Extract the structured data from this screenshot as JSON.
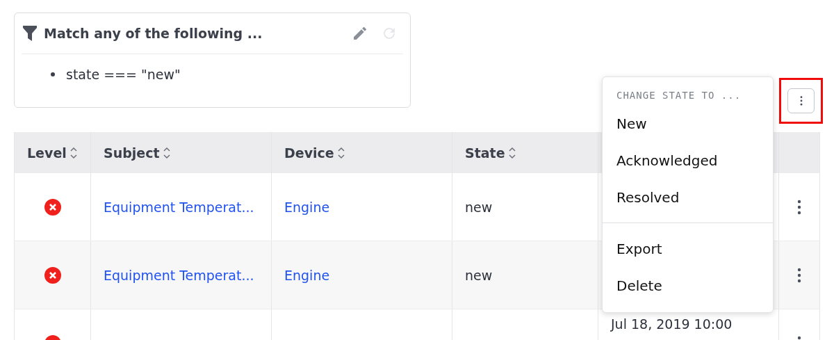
{
  "filter": {
    "title": "Match any of the following ...",
    "conditions": [
      "state === \"new\""
    ]
  },
  "table": {
    "columns": [
      "Level",
      "Subject",
      "Device",
      "State"
    ],
    "rows": [
      {
        "kind": "error",
        "subject": "Equipment Temperat...",
        "device": "Engine",
        "state": "new"
      },
      {
        "kind": "error",
        "subject": "Equipment Temperat...",
        "device": "Engine",
        "state": "new"
      },
      {
        "kind": "error",
        "date": "Jul 18, 2019 10:00"
      }
    ]
  },
  "more_button": {
    "highlighted": true
  },
  "menu": {
    "heading": "CHANGE STATE TO ...",
    "state_items": [
      "New",
      "Acknowledged",
      "Resolved"
    ],
    "other_items": [
      "Export",
      "Delete"
    ]
  }
}
